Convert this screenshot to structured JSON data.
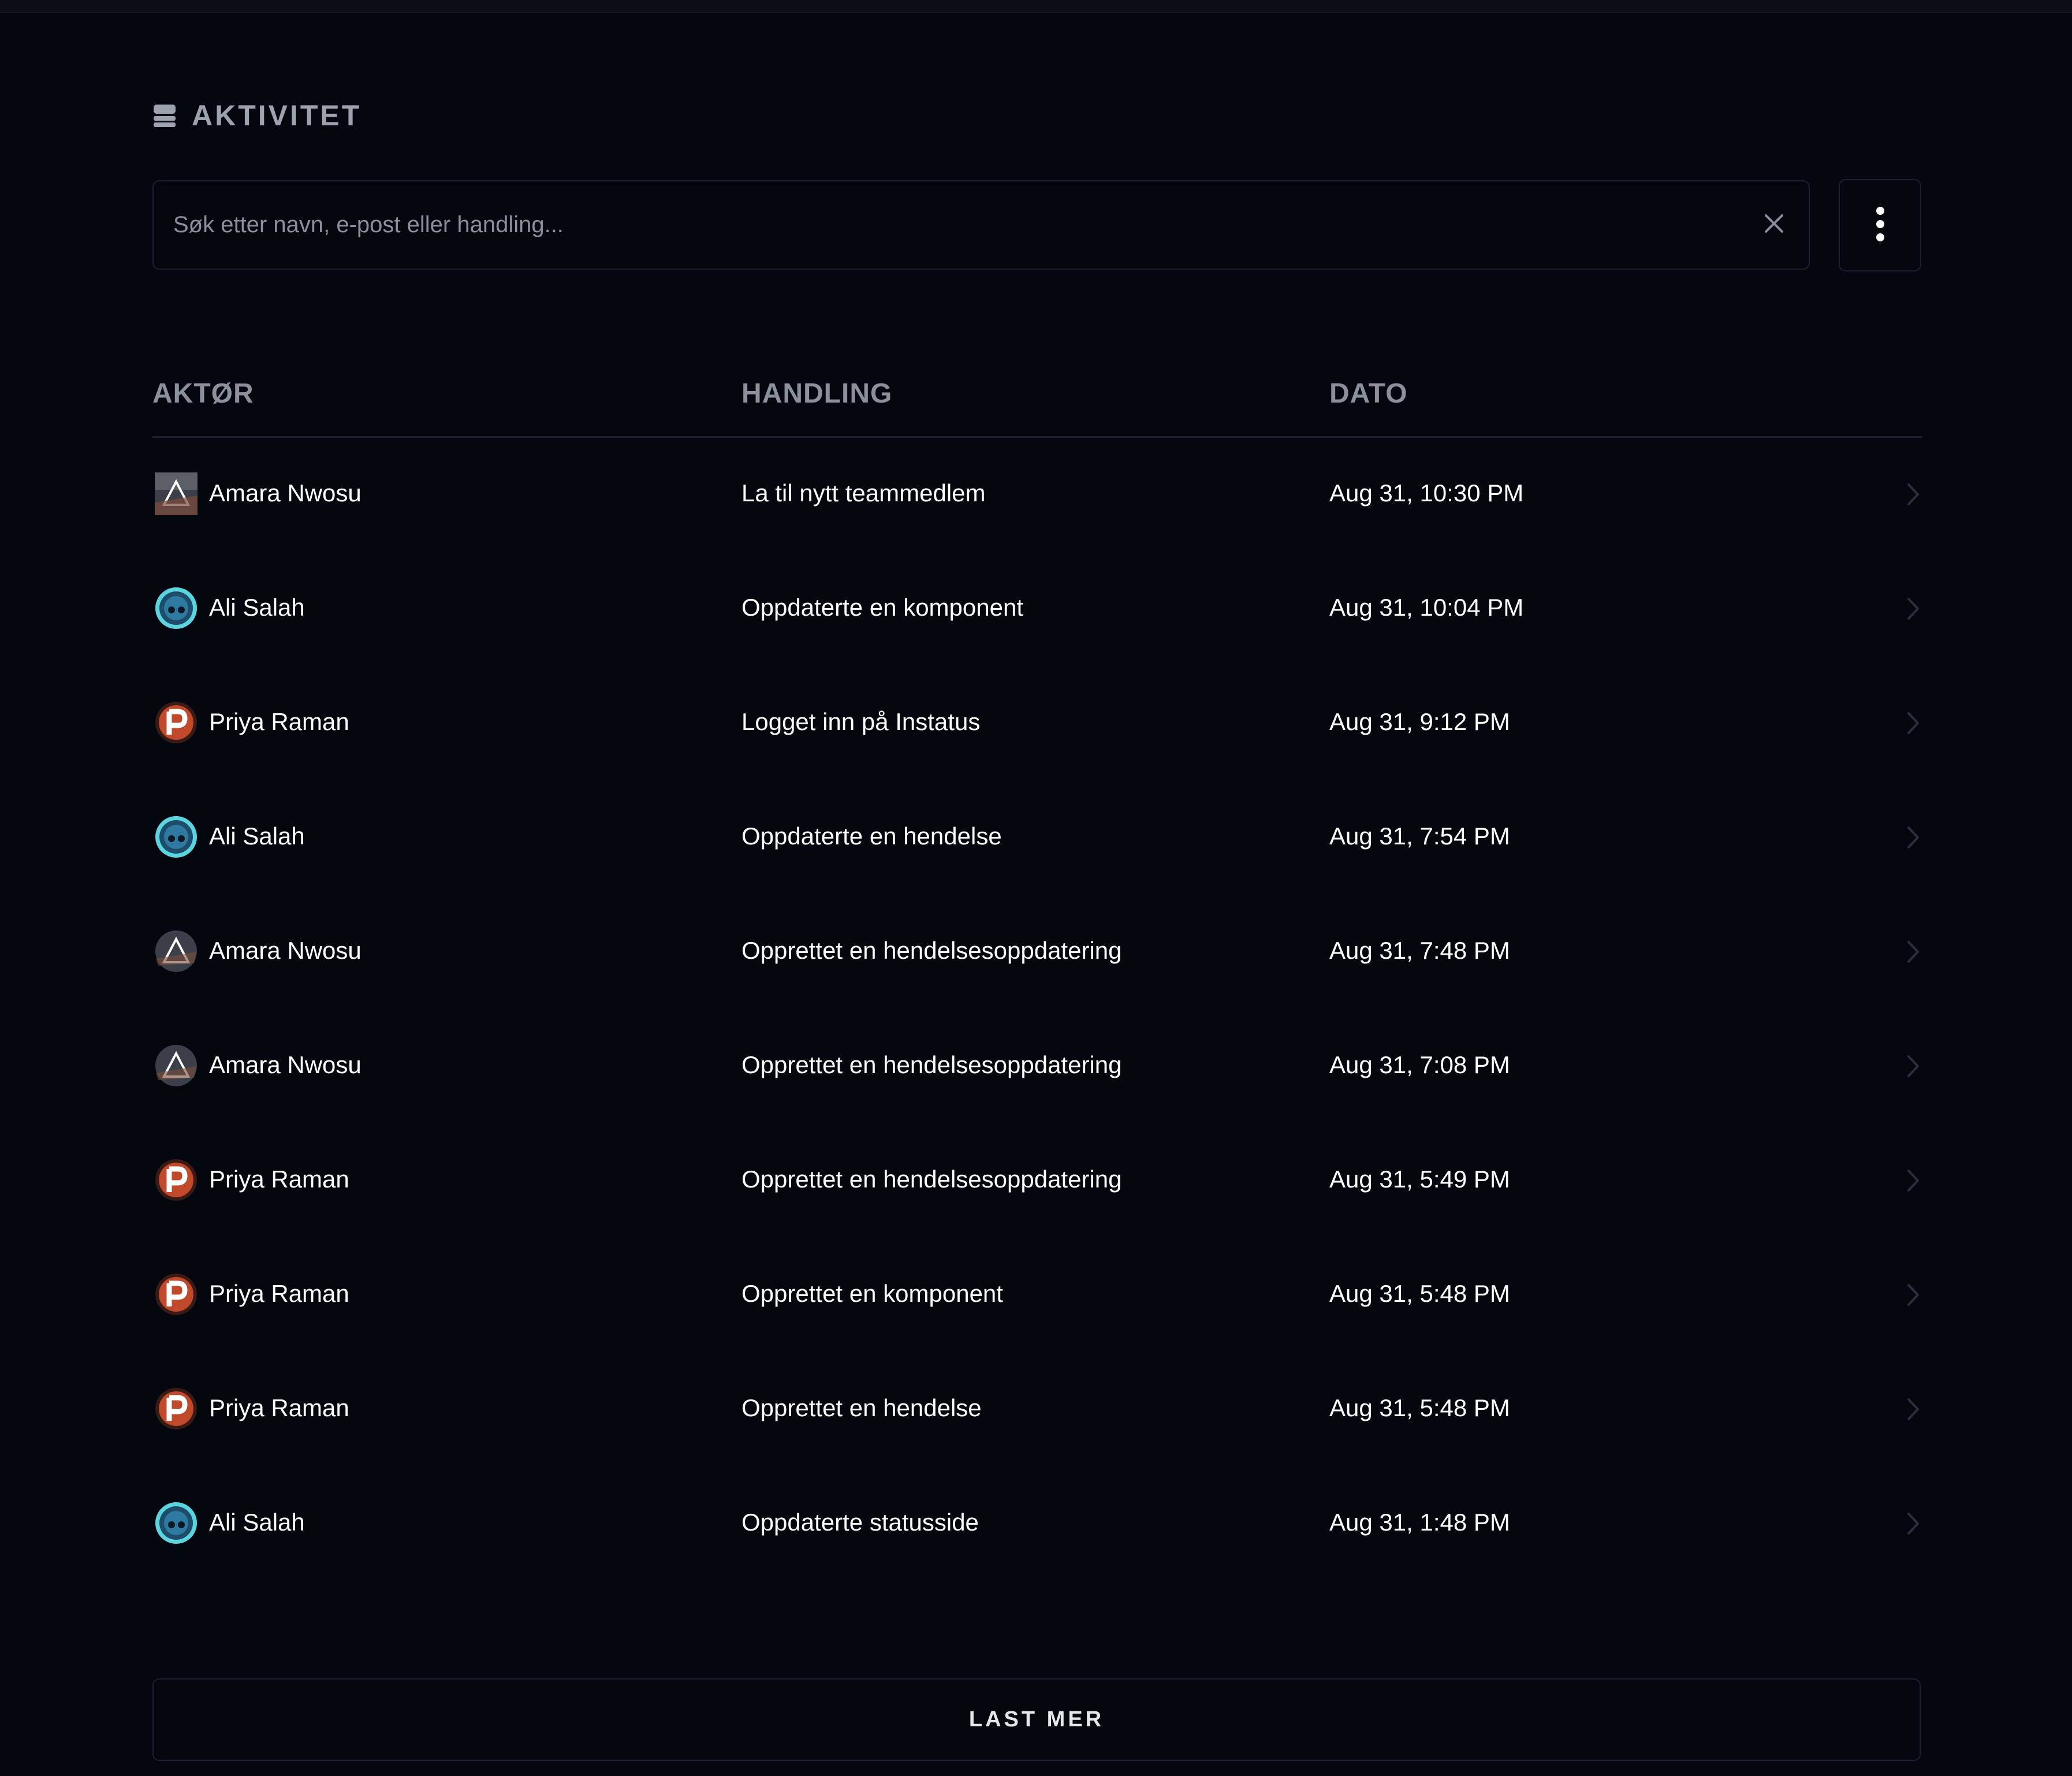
{
  "section": {
    "title": "AKTIVITET",
    "icon": "database-icon"
  },
  "search": {
    "value": "",
    "placeholder": "Søk etter navn, e-post eller handling...",
    "clear_icon": "close-icon"
  },
  "menu_icon": "more-vertical-icon",
  "table": {
    "columns": {
      "actor": "AKTØR",
      "action": "HANDLING",
      "date": "DATO"
    },
    "rows": [
      {
        "actor": "Amara Nwosu",
        "avatar": "avatar-triangle",
        "action": "La til nytt teammedlem",
        "date": "Aug 31, 10:30 PM"
      },
      {
        "actor": "Ali Salah",
        "avatar": "avatar-teal",
        "action": "Oppdaterte en komponent",
        "date": "Aug 31, 10:04 PM"
      },
      {
        "actor": "Priya Raman",
        "avatar": "avatar-p",
        "action": "Logget inn på Instatus",
        "date": "Aug 31, 9:12 PM"
      },
      {
        "actor": "Ali Salah",
        "avatar": "avatar-teal",
        "action": "Oppdaterte en hendelse",
        "date": "Aug 31, 7:54 PM"
      },
      {
        "actor": "Amara Nwosu",
        "avatar": "avatar-triangle",
        "action": "Opprettet en hendelsesoppdatering",
        "date": "Aug 31, 7:48 PM"
      },
      {
        "actor": "Amara Nwosu",
        "avatar": "avatar-triangle",
        "action": "Opprettet en hendelsesoppdatering",
        "date": "Aug 31, 7:08 PM"
      },
      {
        "actor": "Priya Raman",
        "avatar": "avatar-p",
        "action": "Opprettet en hendelsesoppdatering",
        "date": "Aug 31, 5:49 PM"
      },
      {
        "actor": "Priya Raman",
        "avatar": "avatar-p",
        "action": "Opprettet en komponent",
        "date": "Aug 31, 5:48 PM"
      },
      {
        "actor": "Priya Raman",
        "avatar": "avatar-p",
        "action": "Opprettet en hendelse",
        "date": "Aug 31, 5:48 PM"
      },
      {
        "actor": "Ali Salah",
        "avatar": "avatar-teal",
        "action": "Oppdaterte statusside",
        "date": "Aug 31, 1:48 PM"
      }
    ],
    "row_icon": "chevron-right-icon"
  },
  "load_more": {
    "label": "LAST MER"
  },
  "colors": {
    "background": "#05070f",
    "border": "#1c2130",
    "muted_text": "#9ca3af",
    "text": "#ffffff"
  }
}
